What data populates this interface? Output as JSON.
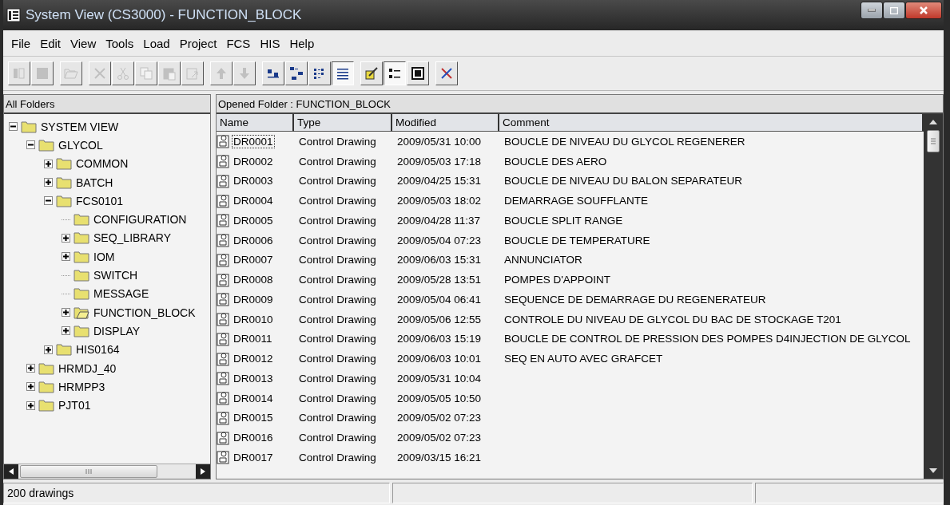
{
  "window": {
    "title": "System View (CS3000) - FUNCTION_BLOCK"
  },
  "menu": [
    "File",
    "Edit",
    "View",
    "Tools",
    "Load",
    "Project",
    "FCS",
    "HIS",
    "Help"
  ],
  "toolbar": [
    [
      {
        "kind": "columns",
        "disabled": true,
        "pressed": false
      },
      {
        "kind": "stop",
        "disabled": true,
        "pressed": false
      }
    ],
    [
      {
        "kind": "open",
        "disabled": true,
        "pressed": false
      }
    ],
    [
      {
        "kind": "delete",
        "disabled": true,
        "pressed": false
      },
      {
        "kind": "cut",
        "disabled": true,
        "pressed": false
      },
      {
        "kind": "copy",
        "disabled": true,
        "pressed": false
      },
      {
        "kind": "paste",
        "disabled": true,
        "pressed": false
      },
      {
        "kind": "paste-link",
        "disabled": true,
        "pressed": false
      }
    ],
    [
      {
        "kind": "up",
        "disabled": true,
        "pressed": false
      },
      {
        "kind": "down",
        "disabled": true,
        "pressed": false
      }
    ],
    [
      {
        "kind": "large",
        "disabled": false,
        "pressed": false
      },
      {
        "kind": "small",
        "disabled": false,
        "pressed": false
      },
      {
        "kind": "list",
        "disabled": false,
        "pressed": false
      },
      {
        "kind": "details",
        "disabled": false,
        "pressed": true
      }
    ],
    [
      {
        "kind": "edit",
        "disabled": false,
        "pressed": false
      },
      {
        "kind": "sort",
        "disabled": false,
        "pressed": true
      },
      {
        "kind": "calc",
        "disabled": false,
        "pressed": false
      }
    ],
    [
      {
        "kind": "tools",
        "disabled": false,
        "pressed": false
      }
    ]
  ],
  "tree": {
    "header": "All Folders",
    "items": [
      {
        "label": "SYSTEM VIEW",
        "expandable": true,
        "expanded": true,
        "selected": false,
        "children": [
          {
            "label": "GLYCOL",
            "expandable": true,
            "expanded": true,
            "selected": false,
            "children": [
              {
                "label": "COMMON",
                "expandable": true,
                "expanded": false,
                "selected": false
              },
              {
                "label": "BATCH",
                "expandable": true,
                "expanded": false,
                "selected": false
              },
              {
                "label": "FCS0101",
                "expandable": true,
                "expanded": true,
                "selected": false,
                "children": [
                  {
                    "label": "CONFIGURATION",
                    "expandable": false,
                    "expanded": false,
                    "selected": false
                  },
                  {
                    "label": "SEQ_LIBRARY",
                    "expandable": true,
                    "expanded": false,
                    "selected": false
                  },
                  {
                    "label": "IOM",
                    "expandable": true,
                    "expanded": false,
                    "selected": false
                  },
                  {
                    "label": "SWITCH",
                    "expandable": false,
                    "expanded": false,
                    "selected": false
                  },
                  {
                    "label": "MESSAGE",
                    "expandable": false,
                    "expanded": false,
                    "selected": false
                  },
                  {
                    "label": "FUNCTION_BLOCK",
                    "expandable": true,
                    "expanded": false,
                    "selected": true
                  },
                  {
                    "label": "DISPLAY",
                    "expandable": true,
                    "expanded": false,
                    "selected": false
                  }
                ]
              },
              {
                "label": "HIS0164",
                "expandable": true,
                "expanded": false,
                "selected": false
              }
            ]
          },
          {
            "label": "HRMDJ_40",
            "expandable": true,
            "expanded": false,
            "selected": false
          },
          {
            "label": "HRMPP3",
            "expandable": true,
            "expanded": false,
            "selected": false
          },
          {
            "label": "PJT01",
            "expandable": true,
            "expanded": false,
            "selected": false
          }
        ]
      }
    ]
  },
  "list": {
    "header": "Opened Folder : FUNCTION_BLOCK",
    "columns": [
      "Name",
      "Type",
      "Modified",
      "Comment"
    ],
    "rows": [
      {
        "name": "DR0001",
        "type": "Control Drawing",
        "modified": "2009/05/31 10:00",
        "comment": "BOUCLE DE NIVEAU DU GLYCOL REGENERER",
        "focused": true
      },
      {
        "name": "DR0002",
        "type": "Control Drawing",
        "modified": "2009/05/03 17:18",
        "comment": "BOUCLE DES AERO",
        "focused": false
      },
      {
        "name": "DR0003",
        "type": "Control Drawing",
        "modified": "2009/04/25 15:31",
        "comment": "BOUCLE DE NIVEAU DU BALON SEPARATEUR",
        "focused": false
      },
      {
        "name": "DR0004",
        "type": "Control Drawing",
        "modified": "2009/05/03 18:02",
        "comment": "DEMARRAGE SOUFFLANTE",
        "focused": false
      },
      {
        "name": "DR0005",
        "type": "Control Drawing",
        "modified": "2009/04/28 11:37",
        "comment": "BOUCLE SPLIT RANGE",
        "focused": false
      },
      {
        "name": "DR0006",
        "type": "Control Drawing",
        "modified": "2009/05/04 07:23",
        "comment": "BOUCLE DE TEMPERATURE",
        "focused": false
      },
      {
        "name": "DR0007",
        "type": "Control Drawing",
        "modified": "2009/06/03 15:31",
        "comment": "ANNUNCIATOR",
        "focused": false
      },
      {
        "name": "DR0008",
        "type": "Control Drawing",
        "modified": "2009/05/28 13:51",
        "comment": "POMPES D'APPOINT",
        "focused": false
      },
      {
        "name": "DR0009",
        "type": "Control Drawing",
        "modified": "2009/05/04 06:41",
        "comment": "SEQUENCE DE DEMARRAGE DU REGENERATEUR",
        "focused": false
      },
      {
        "name": "DR0010",
        "type": "Control Drawing",
        "modified": "2009/05/06 12:55",
        "comment": "CONTROLE DU NIVEAU DE GLYCOL DU BAC DE STOCKAGE T201",
        "focused": false
      },
      {
        "name": "DR0011",
        "type": "Control Drawing",
        "modified": "2009/06/03 15:19",
        "comment": "BOUCLE DE CONTROL DE PRESSION DES POMPES D4INJECTION DE GLYCOL",
        "focused": false
      },
      {
        "name": "DR0012",
        "type": "Control Drawing",
        "modified": "2009/06/03 10:01",
        "comment": "SEQ EN AUTO AVEC GRAFCET",
        "focused": false
      },
      {
        "name": "DR0013",
        "type": "Control Drawing",
        "modified": "2009/05/31 10:04",
        "focused": false
      },
      {
        "name": "DR0014",
        "type": "Control Drawing",
        "modified": "2009/05/05 10:50",
        "focused": false
      },
      {
        "name": "DR0015",
        "type": "Control Drawing",
        "modified": "2009/05/02 07:23",
        "focused": false
      },
      {
        "name": "DR0016",
        "type": "Control Drawing",
        "modified": "2009/05/02 07:23",
        "focused": false
      },
      {
        "name": "DR0017",
        "type": "Control Drawing",
        "modified": "2009/03/15 16:21",
        "focused": false
      }
    ]
  },
  "status_bar": {
    "text": "200 drawings"
  }
}
